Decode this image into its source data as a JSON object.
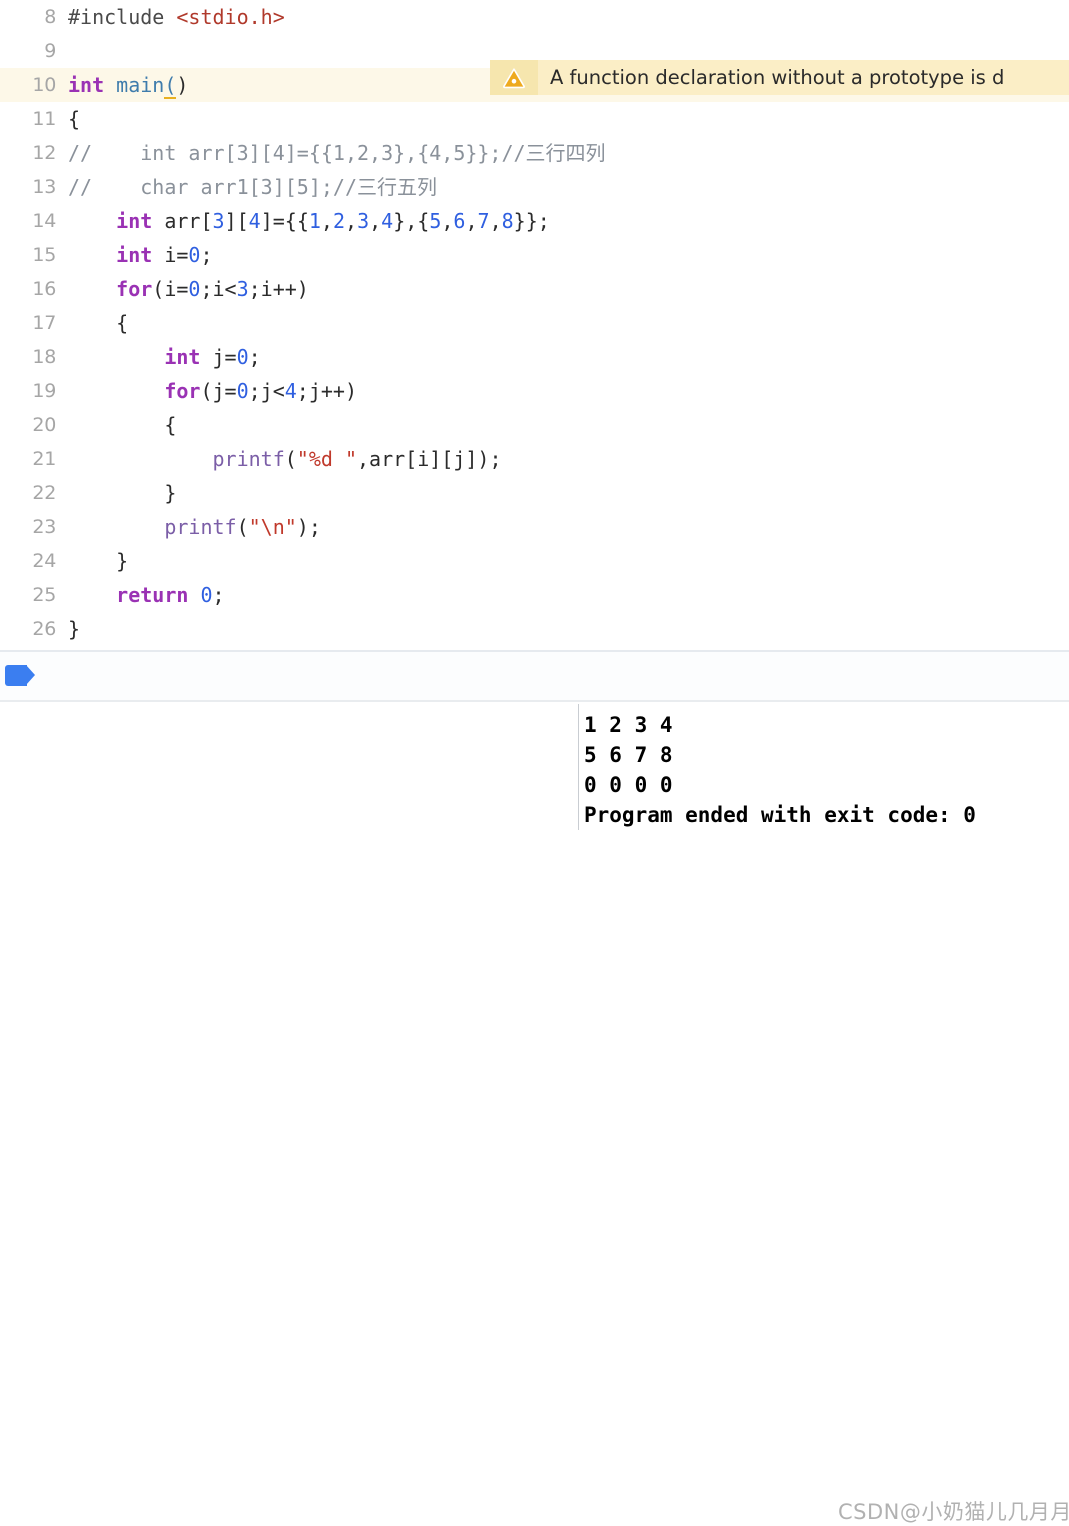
{
  "editor": {
    "first_line_number": 8,
    "highlighted_line": 10,
    "lines": [
      {
        "n": "8",
        "tokens": [
          {
            "t": "#include ",
            "c": "prep"
          },
          {
            "t": "<stdio.h>",
            "c": "hdr"
          }
        ]
      },
      {
        "n": "9",
        "tokens": []
      },
      {
        "n": "10",
        "tokens": [
          {
            "t": "int",
            "c": "kw"
          },
          {
            "t": " ",
            "c": "plain"
          },
          {
            "t": "main",
            "c": "fn"
          },
          {
            "t": "(",
            "c": "fn-u"
          },
          {
            "t": ")",
            "c": "plain"
          }
        ]
      },
      {
        "n": "11",
        "tokens": [
          {
            "t": "{",
            "c": "plain"
          }
        ]
      },
      {
        "n": "12",
        "tokens": [
          {
            "t": "//    int arr[3][4]={{1,2,3},{4,5}};//三行四列",
            "c": "cmt"
          }
        ]
      },
      {
        "n": "13",
        "tokens": [
          {
            "t": "//    char arr1[3][5];//三行五列",
            "c": "cmt"
          }
        ]
      },
      {
        "n": "14",
        "tokens": [
          {
            "t": "    ",
            "c": "plain"
          },
          {
            "t": "int",
            "c": "kw"
          },
          {
            "t": " arr[",
            "c": "plain"
          },
          {
            "t": "3",
            "c": "num"
          },
          {
            "t": "][",
            "c": "plain"
          },
          {
            "t": "4",
            "c": "num"
          },
          {
            "t": "]={{",
            "c": "plain"
          },
          {
            "t": "1",
            "c": "num"
          },
          {
            "t": ",",
            "c": "plain"
          },
          {
            "t": "2",
            "c": "num"
          },
          {
            "t": ",",
            "c": "plain"
          },
          {
            "t": "3",
            "c": "num"
          },
          {
            "t": ",",
            "c": "plain"
          },
          {
            "t": "4",
            "c": "num"
          },
          {
            "t": "},{",
            "c": "plain"
          },
          {
            "t": "5",
            "c": "num"
          },
          {
            "t": ",",
            "c": "plain"
          },
          {
            "t": "6",
            "c": "num"
          },
          {
            "t": ",",
            "c": "plain"
          },
          {
            "t": "7",
            "c": "num"
          },
          {
            "t": ",",
            "c": "plain"
          },
          {
            "t": "8",
            "c": "num"
          },
          {
            "t": "}};",
            "c": "plain"
          }
        ]
      },
      {
        "n": "15",
        "tokens": [
          {
            "t": "    ",
            "c": "plain"
          },
          {
            "t": "int",
            "c": "kw"
          },
          {
            "t": " i=",
            "c": "plain"
          },
          {
            "t": "0",
            "c": "num"
          },
          {
            "t": ";",
            "c": "plain"
          }
        ]
      },
      {
        "n": "16",
        "tokens": [
          {
            "t": "    ",
            "c": "plain"
          },
          {
            "t": "for",
            "c": "kw"
          },
          {
            "t": "(i=",
            "c": "plain"
          },
          {
            "t": "0",
            "c": "num"
          },
          {
            "t": ";i<",
            "c": "plain"
          },
          {
            "t": "3",
            "c": "num"
          },
          {
            "t": ";i++)",
            "c": "plain"
          }
        ]
      },
      {
        "n": "17",
        "tokens": [
          {
            "t": "    {",
            "c": "plain"
          }
        ]
      },
      {
        "n": "18",
        "tokens": [
          {
            "t": "        ",
            "c": "plain"
          },
          {
            "t": "int",
            "c": "kw"
          },
          {
            "t": " j=",
            "c": "plain"
          },
          {
            "t": "0",
            "c": "num"
          },
          {
            "t": ";",
            "c": "plain"
          }
        ]
      },
      {
        "n": "19",
        "tokens": [
          {
            "t": "        ",
            "c": "plain"
          },
          {
            "t": "for",
            "c": "kw"
          },
          {
            "t": "(j=",
            "c": "plain"
          },
          {
            "t": "0",
            "c": "num"
          },
          {
            "t": ";j<",
            "c": "plain"
          },
          {
            "t": "4",
            "c": "num"
          },
          {
            "t": ";j++)",
            "c": "plain"
          }
        ]
      },
      {
        "n": "20",
        "tokens": [
          {
            "t": "        {",
            "c": "plain"
          }
        ]
      },
      {
        "n": "21",
        "tokens": [
          {
            "t": "            ",
            "c": "plain"
          },
          {
            "t": "printf",
            "c": "call"
          },
          {
            "t": "(",
            "c": "plain"
          },
          {
            "t": "\"%d \"",
            "c": "str"
          },
          {
            "t": ",arr[i][j]);",
            "c": "plain"
          }
        ]
      },
      {
        "n": "22",
        "tokens": [
          {
            "t": "        }",
            "c": "plain"
          }
        ]
      },
      {
        "n": "23",
        "tokens": [
          {
            "t": "        ",
            "c": "plain"
          },
          {
            "t": "printf",
            "c": "call"
          },
          {
            "t": "(",
            "c": "plain"
          },
          {
            "t": "\"\\n\"",
            "c": "str"
          },
          {
            "t": ");",
            "c": "plain"
          }
        ]
      },
      {
        "n": "24",
        "tokens": [
          {
            "t": "    }",
            "c": "plain"
          }
        ]
      },
      {
        "n": "25",
        "tokens": [
          {
            "t": "    ",
            "c": "plain"
          },
          {
            "t": "return",
            "c": "kw"
          },
          {
            "t": " ",
            "c": "plain"
          },
          {
            "t": "0",
            "c": "num"
          },
          {
            "t": ";",
            "c": "plain"
          }
        ]
      },
      {
        "n": "26",
        "tokens": [
          {
            "t": "}",
            "c": "plain"
          }
        ]
      }
    ]
  },
  "warning": {
    "icon": "warning-triangle-icon",
    "message": "A function declaration without a prototype is d",
    "background_color": "#fbeec6",
    "icon_background_color": "#f6e6ae",
    "icon_color": "#eeaa1f",
    "line_highlight_color": "#fdf8e8"
  },
  "toolbar": {
    "breadcrumb_tag_color": "#3b7ef0"
  },
  "console": {
    "output": "1 2 3 4\n5 6 7 8\n0 0 0 0\nProgram ended with exit code: 0",
    "lines": [
      "1 2 3 4",
      "5 6 7 8",
      "0 0 0 0",
      "Program ended with exit code: 0"
    ]
  },
  "watermark": {
    "text": "CSDN@小奶猫儿几月月"
  },
  "colors": {
    "keyword": "#9a32b4",
    "number": "#2f5fe0",
    "string": "#c0392b",
    "comment": "#8a919a",
    "function": "#3f7cac",
    "call": "#7b5ea7",
    "header": "#b0392b",
    "plain": "#2b2b2b",
    "gutter": "#a6a6a6"
  }
}
